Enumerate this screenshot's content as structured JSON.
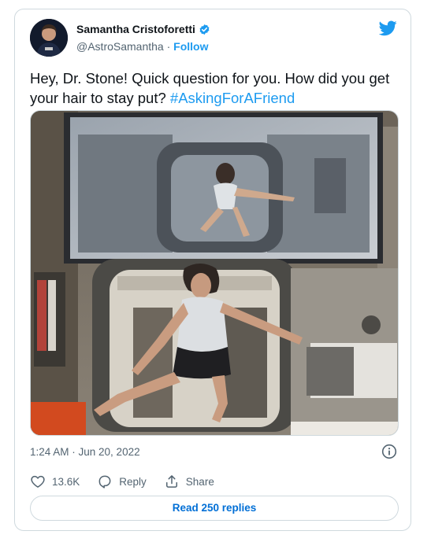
{
  "author": {
    "display_name": "Samantha Cristoforetti",
    "handle": "@AstroSamantha",
    "separator": "·",
    "follow_label": "Follow"
  },
  "tweet": {
    "text": "Hey, Dr. Stone! Quick question for you. How did you get your hair to stay put? ",
    "hashtag": "#AskingForAFriend",
    "timestamp": "1:24 AM · Jun 20, 2022"
  },
  "actions": {
    "likes": "13.6K",
    "reply_label": "Reply",
    "share_label": "Share"
  },
  "read_replies_label": "Read 250 replies",
  "icons": {
    "brand": "twitter-bird-icon",
    "verified": "verified-badge-icon",
    "info": "info-icon",
    "like": "heart-icon",
    "reply": "reply-bubble-icon",
    "share": "share-upload-icon"
  },
  "colors": {
    "accent": "#1d9bf0",
    "link_strong": "#006fd6",
    "text": "#0f1419",
    "muted": "#536471",
    "border": "#cfd9de"
  }
}
